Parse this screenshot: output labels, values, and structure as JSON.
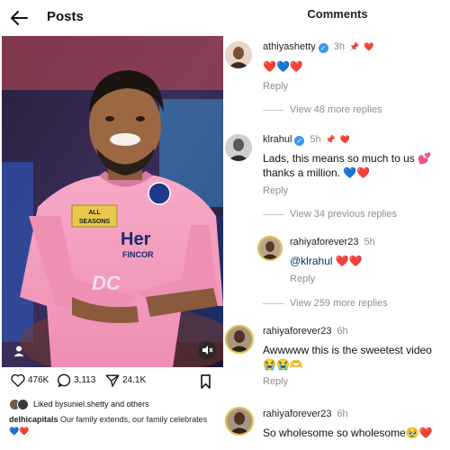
{
  "left": {
    "title": "Posts",
    "actions": {
      "likes": "476K",
      "comments": "3,113",
      "shares": "24.1K"
    },
    "liked_by": {
      "prefix": "Liked by ",
      "user": "suniel.shetty",
      "suffix": " and others"
    },
    "caption": {
      "user": "delhicapitals",
      "text": " Our family extends, our family celebrates 💙❤️"
    },
    "jersey": {
      "sponsor1": "ALL",
      "sponsor2": "SEASONS",
      "sponsor3": "Her",
      "sponsor4": "FINCOR",
      "logo": "DC"
    }
  },
  "right": {
    "title": "Comments",
    "comments": [
      {
        "user": "athiyashetty",
        "time": "3h",
        "text": "❤️💙❤️",
        "reply": "Reply",
        "view": "View 48 more replies"
      },
      {
        "user": "klrahul",
        "time": "5h",
        "text": "Lads, this means so much to us 💕 thanks a million. 💙❤️",
        "reply": "Reply",
        "view": "View 34 previous replies"
      },
      {
        "user": "rahiyaforever23",
        "time": "5h",
        "mention": "@klrahul",
        "text": " ❤️❤️",
        "reply": "Reply",
        "view": "View 259 more replies"
      },
      {
        "user": "rahiyaforever23",
        "time": "6h",
        "text": "Awwwww this is the sweetest video 😭😭🫶",
        "reply": "Reply"
      },
      {
        "user": "rahiyaforever23",
        "time": "6h",
        "text": "So wholesome so wholesome🥹❤️"
      }
    ],
    "badges": {
      "pin": "📌",
      "heart": "❤️",
      "dc": "•"
    }
  }
}
